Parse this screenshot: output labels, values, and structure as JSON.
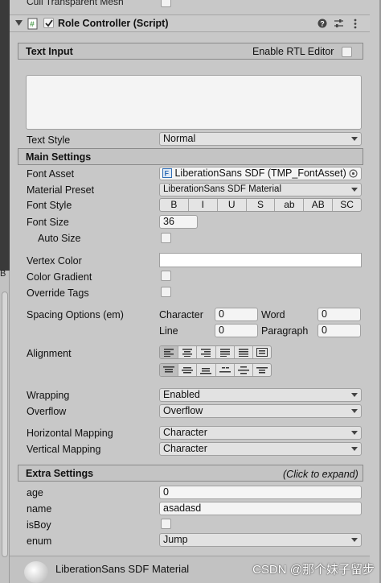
{
  "top_row": {
    "label": "Cull Transparent Mesh"
  },
  "component": {
    "title": "Role Controller (Script)",
    "help_icon": "question-icon",
    "settings_icon": "sliders-icon",
    "menu_icon": "kebab-icon"
  },
  "text_input": {
    "section_title": "Text Input",
    "rtl_label": "Enable RTL Editor",
    "text_style_label": "Text Style",
    "text_style_value": "Normal"
  },
  "main_settings": {
    "section_title": "Main Settings",
    "font_asset_label": "Font Asset",
    "font_asset_value": "LiberationSans SDF (TMP_FontAsset)",
    "material_preset_label": "Material Preset",
    "material_preset_value": "LiberationSans SDF Material",
    "font_style_label": "Font Style",
    "font_style_buttons": [
      "B",
      "I",
      "U",
      "S",
      "ab",
      "AB",
      "SC"
    ],
    "font_size_label": "Font Size",
    "font_size_value": "36",
    "auto_size_label": "Auto Size",
    "vertex_color_label": "Vertex Color",
    "vertex_color": "#ffffff",
    "color_gradient_label": "Color Gradient",
    "override_tags_label": "Override Tags",
    "spacing_label": "Spacing Options (em)",
    "character_label": "Character",
    "character_value": "0",
    "word_label": "Word",
    "word_value": "0",
    "line_label": "Line",
    "line_value": "0",
    "paragraph_label": "Paragraph",
    "paragraph_value": "0",
    "alignment_label": "Alignment",
    "wrapping_label": "Wrapping",
    "wrapping_value": "Enabled",
    "overflow_label": "Overflow",
    "overflow_value": "Overflow",
    "horizontal_mapping_label": "Horizontal Mapping",
    "horizontal_mapping_value": "Character",
    "vertical_mapping_label": "Vertical Mapping",
    "vertical_mapping_value": "Character"
  },
  "extra_settings": {
    "section_title": "Extra Settings",
    "hint": "(Click to expand)"
  },
  "fields": {
    "age_label": "age",
    "age_value": "0",
    "name_label": "name",
    "name_value": "asadasd",
    "isboy_label": "isBoy",
    "enum_label": "enum",
    "enum_value": "Jump"
  },
  "material_bar": {
    "label": "LiberationSans SDF Material"
  },
  "left_strip": {
    "label": "B"
  },
  "watermark": "CSDN @那个妹子留步",
  "colors": {
    "panel_bg": "#c8c8c8",
    "section_bg": "#c4c4c4",
    "field_bg": "#f4f4f4",
    "selected_button": "#bdbdbd"
  }
}
